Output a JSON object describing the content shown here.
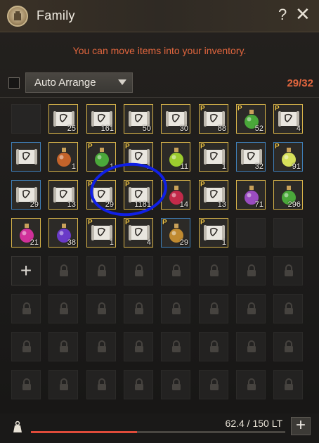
{
  "window": {
    "title": "Family",
    "help_icon": "?",
    "close_icon": "✕"
  },
  "notice": "You can move items into your inventory.",
  "toolbar": {
    "sort_label": "Auto Arrange",
    "capacity": "29/32"
  },
  "colors": {
    "accent_orange": "#e2663e",
    "gold_border": "#d8b44a",
    "blue_border": "#3f7fb8",
    "highlight_ring": "#1020e6",
    "weight_fill": "#e04b3a"
  },
  "grid": {
    "columns": 8,
    "rows": 8,
    "slots": [
      {
        "kind": "empty"
      },
      {
        "kind": "item",
        "icon": "scroll-icon",
        "qty": "25",
        "border": "gold"
      },
      {
        "kind": "item",
        "icon": "scroll-icon",
        "qty": "161",
        "border": "gold"
      },
      {
        "kind": "item",
        "icon": "scroll-icon",
        "qty": "50",
        "border": "gold"
      },
      {
        "kind": "item",
        "icon": "scroll-icon",
        "qty": "30",
        "border": "gold"
      },
      {
        "kind": "item",
        "icon": "scroll-icon",
        "qty": "88",
        "border": "gold",
        "p": true
      },
      {
        "kind": "item",
        "icon": "green-potion-icon",
        "qty": "52",
        "border": "gold",
        "p": true
      },
      {
        "kind": "item",
        "icon": "scroll-icon",
        "qty": "4",
        "border": "gold",
        "p": true
      },
      {
        "kind": "item",
        "icon": "scroll-icon",
        "qty": "",
        "border": "blue"
      },
      {
        "kind": "item",
        "icon": "orange-potion-icon",
        "qty": "1",
        "border": "gold"
      },
      {
        "kind": "item",
        "icon": "green-potion-icon",
        "qty": "1",
        "border": "gold",
        "p": true
      },
      {
        "kind": "item",
        "icon": "scroll-icon",
        "qty": "1",
        "border": "gold",
        "p": true
      },
      {
        "kind": "item",
        "icon": "lime-potion-icon",
        "qty": "11",
        "border": "gold"
      },
      {
        "kind": "item",
        "icon": "scroll-icon",
        "qty": "1",
        "border": "gold",
        "p": true
      },
      {
        "kind": "item",
        "icon": "scroll-icon",
        "qty": "32",
        "border": "blue"
      },
      {
        "kind": "item",
        "icon": "yellow-potion-icon",
        "qty": "91",
        "border": "blue",
        "p": true
      },
      {
        "kind": "item",
        "icon": "scroll-icon",
        "qty": "29",
        "border": "blue"
      },
      {
        "kind": "item",
        "icon": "scroll-icon",
        "qty": "13",
        "border": "gold"
      },
      {
        "kind": "item",
        "icon": "scroll-icon",
        "qty": "29",
        "border": "gold",
        "p": true
      },
      {
        "kind": "item",
        "icon": "scroll-icon",
        "qty": "1181",
        "border": "gold",
        "p": true
      },
      {
        "kind": "item",
        "icon": "red-potion-icon",
        "qty": "14",
        "border": "gold"
      },
      {
        "kind": "item",
        "icon": "scroll-icon",
        "qty": "13",
        "border": "gold",
        "p": true
      },
      {
        "kind": "item",
        "icon": "purple-potion-icon",
        "qty": "71",
        "border": "gold"
      },
      {
        "kind": "item",
        "icon": "green-potion-icon",
        "qty": "296",
        "border": "gold"
      },
      {
        "kind": "item",
        "icon": "pink-potion-icon",
        "qty": "21",
        "border": "gold"
      },
      {
        "kind": "item",
        "icon": "violet-potion-icon",
        "qty": "38",
        "border": "gold"
      },
      {
        "kind": "item",
        "icon": "scroll-icon",
        "qty": "1",
        "border": "gold",
        "p": true
      },
      {
        "kind": "item",
        "icon": "scroll-icon",
        "qty": "4",
        "border": "gold",
        "p": true
      },
      {
        "kind": "item",
        "icon": "amber-potion-icon",
        "qty": "29",
        "border": "blue",
        "p": true
      },
      {
        "kind": "item",
        "icon": "scroll-icon",
        "qty": "1",
        "border": "gold",
        "p": true
      },
      {
        "kind": "empty"
      },
      {
        "kind": "empty"
      },
      {
        "kind": "add",
        "label": "+"
      },
      {
        "kind": "locked"
      },
      {
        "kind": "locked"
      },
      {
        "kind": "locked"
      },
      {
        "kind": "locked"
      },
      {
        "kind": "locked"
      },
      {
        "kind": "locked"
      },
      {
        "kind": "locked"
      },
      {
        "kind": "locked"
      },
      {
        "kind": "locked"
      },
      {
        "kind": "locked"
      },
      {
        "kind": "locked"
      },
      {
        "kind": "locked"
      },
      {
        "kind": "locked"
      },
      {
        "kind": "locked"
      },
      {
        "kind": "locked"
      },
      {
        "kind": "locked"
      },
      {
        "kind": "locked"
      },
      {
        "kind": "locked"
      },
      {
        "kind": "locked"
      },
      {
        "kind": "locked"
      },
      {
        "kind": "locked"
      },
      {
        "kind": "locked"
      },
      {
        "kind": "locked"
      },
      {
        "kind": "locked"
      },
      {
        "kind": "locked"
      },
      {
        "kind": "locked"
      },
      {
        "kind": "locked"
      },
      {
        "kind": "locked"
      },
      {
        "kind": "locked"
      },
      {
        "kind": "locked"
      },
      {
        "kind": "locked"
      }
    ]
  },
  "footer": {
    "weight_text": "62.4 / 150 LT",
    "weight_fraction": 0.416,
    "plus_label": "+"
  }
}
